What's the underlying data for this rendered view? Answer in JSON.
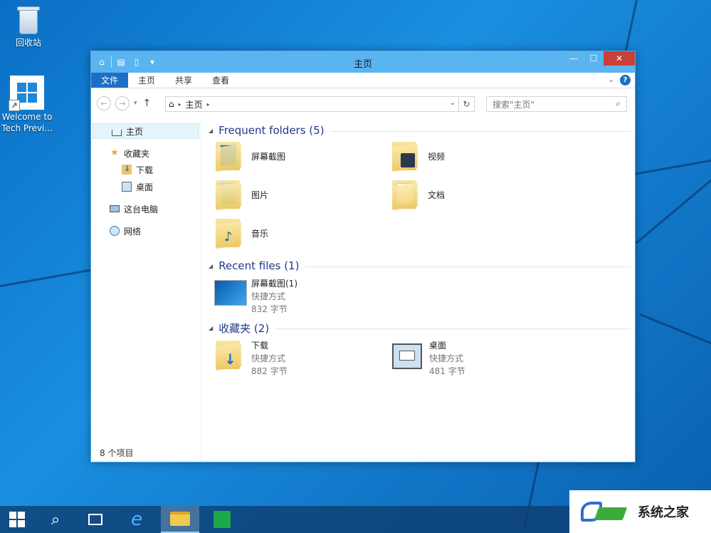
{
  "desktop": {
    "icons": [
      {
        "label": "回收站"
      },
      {
        "label": "Welcome to Tech Previ..."
      }
    ]
  },
  "window": {
    "title": "主页",
    "ribbon_tabs": [
      "文件",
      "主页",
      "共享",
      "查看"
    ],
    "help_label": "?",
    "address": {
      "root": "主页"
    },
    "search_placeholder": "搜索\"主页\"",
    "sidebar": {
      "home": "主页",
      "favorites": "收藏夹",
      "downloads": "下载",
      "desktop": "桌面",
      "this_pc": "这台电脑",
      "network": "网络"
    },
    "groups": {
      "frequent": {
        "header": "Frequent folders (5)",
        "items": [
          {
            "name": "屏幕截图"
          },
          {
            "name": "视频"
          },
          {
            "name": "图片"
          },
          {
            "name": "文档"
          },
          {
            "name": "音乐"
          }
        ]
      },
      "recent": {
        "header": "Recent files (1)",
        "items": [
          {
            "name": "屏幕截图(1)",
            "type": "快捷方式",
            "size": "832 字节"
          }
        ]
      },
      "favorites": {
        "header": "收藏夹 (2)",
        "items": [
          {
            "name": "下载",
            "type": "快捷方式",
            "size": "882 字节"
          },
          {
            "name": "桌面",
            "type": "快捷方式",
            "size": "481 字节"
          }
        ]
      }
    },
    "status": "8 个项目"
  },
  "taskbar": {
    "items": [
      "start",
      "search",
      "task-view",
      "internet-explorer",
      "file-explorer",
      "store"
    ]
  },
  "watermark": {
    "text": "系统之家"
  }
}
